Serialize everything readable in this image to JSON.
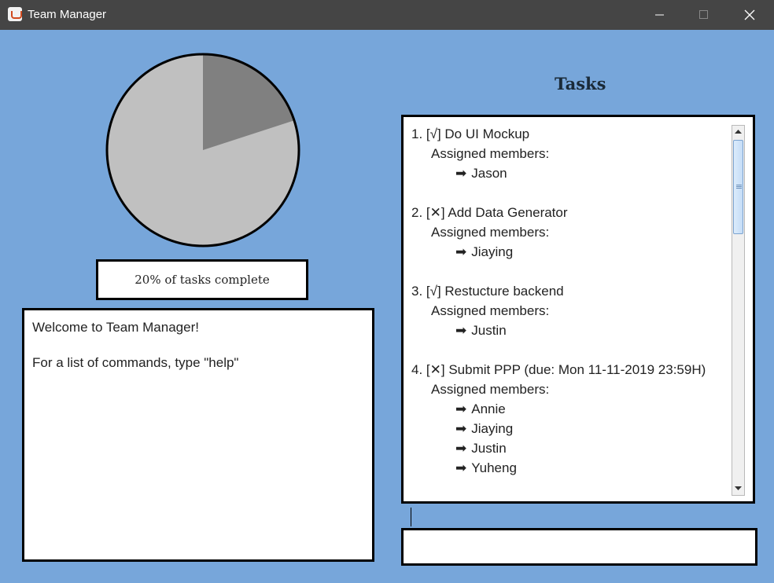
{
  "window": {
    "title": "Team Manager",
    "app_icon": "java-icon"
  },
  "window_controls": {
    "minimize": "minimize-icon",
    "maximize": "maximize-icon",
    "close": "close-icon"
  },
  "progress": {
    "percent_complete": 20,
    "label": "20% of tasks complete",
    "colors": {
      "complete": "#808080",
      "incomplete": "#c0c0c0"
    }
  },
  "console": {
    "lines": [
      "Welcome to Team Manager!",
      "For a list of commands, type \"help\""
    ]
  },
  "tasks": {
    "heading": "Tasks",
    "assigned_label": "Assigned members:",
    "items": [
      {
        "title": "1. [√] Do UI Mockup",
        "members": [
          "Jason"
        ]
      },
      {
        "title": "2. [✕] Add Data Generator",
        "members": [
          "Jiaying"
        ]
      },
      {
        "title": "3. [√] Restucture backend",
        "members": [
          "Justin"
        ]
      },
      {
        "title": "4. [✕] Submit PPP (due: Mon 11-11-2019 23:59H)",
        "members": [
          "Annie",
          "Jiaying",
          "Justin",
          "Yuheng"
        ]
      }
    ]
  },
  "command_box": {
    "value": ""
  },
  "colors": {
    "background": "#77a6da",
    "titlebar": "#454545"
  }
}
